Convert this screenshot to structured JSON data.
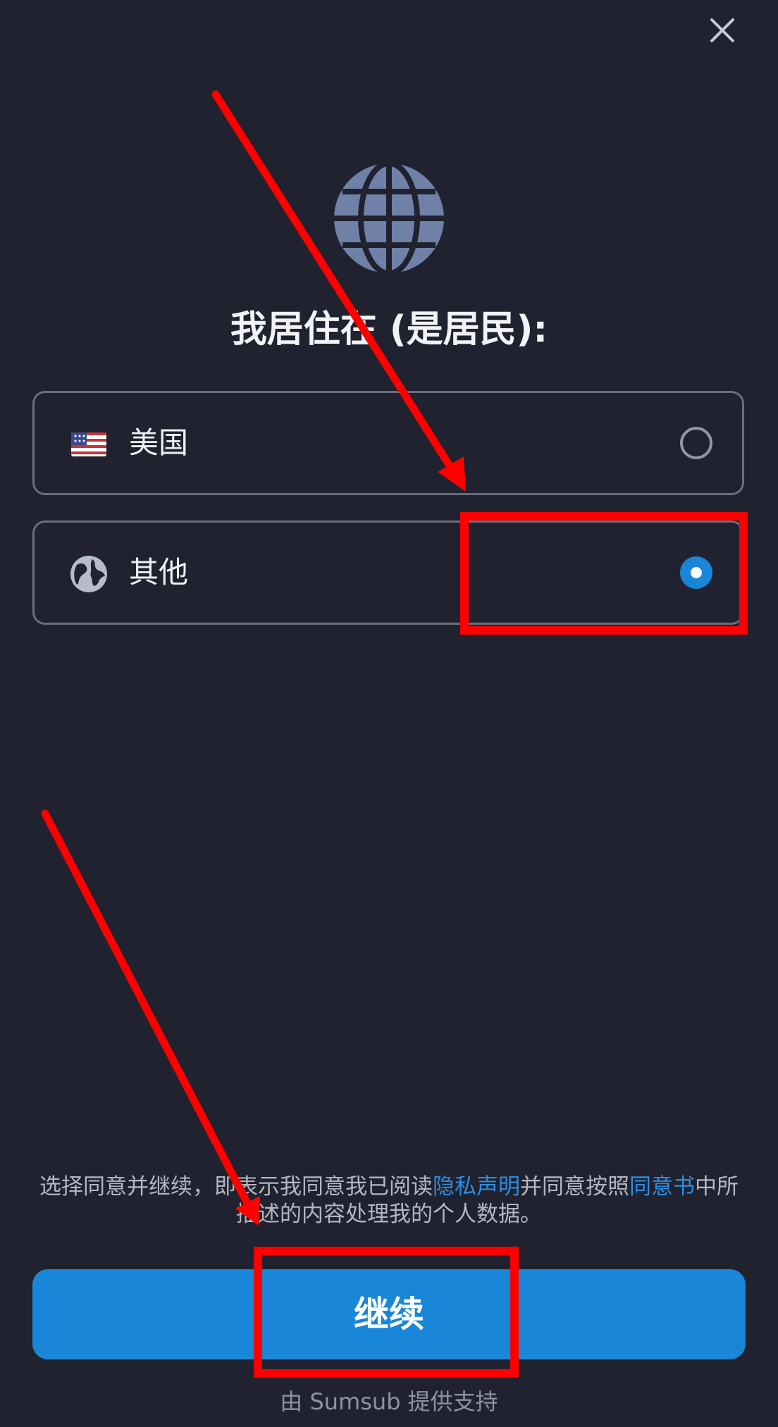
{
  "header": {
    "close_icon": "close-icon"
  },
  "hero": {
    "icon": "globe-icon",
    "icon_color": "#7081a8"
  },
  "title": "我居住在 (是居民):",
  "options": [
    {
      "label": "美国",
      "icon": "us-flag-icon",
      "selected": false
    },
    {
      "label": "其他",
      "icon": "globe-icon",
      "selected": true
    }
  ],
  "consent": {
    "prefix": "选择同意并继续，即表示我同意我已阅读",
    "privacy_link": "隐私声明",
    "middle": "并同意按照",
    "consent_link": "同意书",
    "suffix": "中所描述的内容处理我的个人数据。"
  },
  "continue_button": "继续",
  "powered_by": "由 Sumsub 提供支持",
  "colors": {
    "background": "#20222f",
    "accent": "#1a86d8",
    "annotation": "#ff0000"
  }
}
